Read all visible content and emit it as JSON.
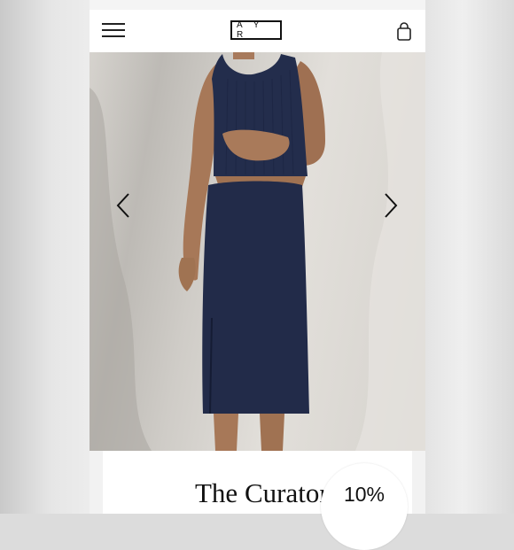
{
  "header": {
    "logo_text": "A Y R",
    "menu_icon": "hamburger-menu-icon",
    "bag_icon": "shopping-bag-icon"
  },
  "carousel": {
    "prev_icon": "chevron-left-icon",
    "next_icon": "chevron-right-icon",
    "image_description": "product-photo-navy-ribbed-top-and-skirt"
  },
  "product": {
    "title": "The Curator"
  },
  "badge": {
    "discount": "10%"
  },
  "colors": {
    "navy": "#1f2a48",
    "text": "#111111",
    "background": "#ffffff"
  }
}
